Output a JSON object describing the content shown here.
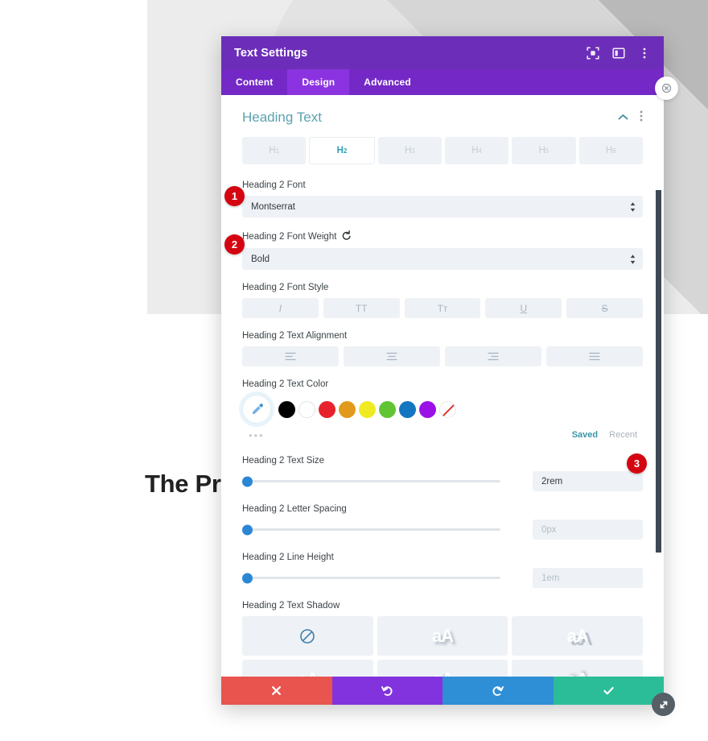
{
  "page_background": {
    "hero_text": "The Pro",
    "panel_color": "#ececec",
    "diag_color": "#b9b9b9"
  },
  "modal": {
    "title": "Text Settings",
    "header_icons": [
      {
        "name": "focus-target-icon"
      },
      {
        "name": "panel-layout-icon"
      },
      {
        "name": "more-vertical-icon"
      }
    ],
    "tabs": [
      {
        "label": "Content",
        "active": false
      },
      {
        "label": "Design",
        "active": true
      },
      {
        "label": "Advanced",
        "active": false
      }
    ],
    "section": {
      "title": "Heading Text",
      "collapse_icon": "chevron-up-icon",
      "menu_icon": "more-vertical-icon"
    },
    "heading_levels": [
      {
        "label": "H",
        "sub": "1",
        "active": false
      },
      {
        "label": "H",
        "sub": "2",
        "active": true
      },
      {
        "label": "H",
        "sub": "3",
        "active": false
      },
      {
        "label": "H",
        "sub": "4",
        "active": false
      },
      {
        "label": "H",
        "sub": "5",
        "active": false
      },
      {
        "label": "H",
        "sub": "6",
        "active": false
      }
    ],
    "fields": {
      "font": {
        "label": "Heading 2 Font",
        "value": "Montserrat"
      },
      "font_weight": {
        "label": "Heading 2 Font Weight",
        "value": "Bold",
        "has_reset": true
      },
      "font_style": {
        "label": "Heading 2 Font Style",
        "options": [
          {
            "name": "italic-icon",
            "glyph": "I"
          },
          {
            "name": "uppercase-icon",
            "glyph": "TT"
          },
          {
            "name": "small-caps-icon",
            "glyph": "Tᴛ"
          },
          {
            "name": "underline-icon",
            "glyph": "U"
          },
          {
            "name": "strikethrough-icon",
            "glyph": "S"
          }
        ]
      },
      "text_alignment": {
        "label": "Heading 2 Text Alignment",
        "options": [
          {
            "name": "align-left-icon"
          },
          {
            "name": "align-center-icon"
          },
          {
            "name": "align-right-icon"
          },
          {
            "name": "align-justify-icon"
          }
        ]
      },
      "text_color": {
        "label": "Heading 2 Text Color",
        "eyedropper": "eyedropper-icon",
        "more_dots": "•••",
        "swatches": [
          {
            "name": "swatch-black",
            "hex": "#000000"
          },
          {
            "name": "swatch-white",
            "hex": "#ffffff"
          },
          {
            "name": "swatch-red",
            "hex": "#e8222a"
          },
          {
            "name": "swatch-orange",
            "hex": "#e19a1c"
          },
          {
            "name": "swatch-yellow",
            "hex": "#f0ea22"
          },
          {
            "name": "swatch-green",
            "hex": "#61c434"
          },
          {
            "name": "swatch-blue",
            "hex": "#1476c0"
          },
          {
            "name": "swatch-purple",
            "hex": "#9c10e8"
          },
          {
            "name": "swatch-none",
            "hex": "transparent"
          }
        ],
        "saved_label": "Saved",
        "recent_label": "Recent"
      },
      "text_size": {
        "label": "Heading 2 Text Size",
        "value": "2rem",
        "is_placeholder": false,
        "thumb_pct": 0
      },
      "letter_spacing": {
        "label": "Heading 2 Letter Spacing",
        "value": "0px",
        "is_placeholder": true,
        "thumb_pct": 0
      },
      "line_height": {
        "label": "Heading 2 Line Height",
        "value": "1em",
        "is_placeholder": true,
        "thumb_pct": 0
      },
      "text_shadow": {
        "label": "Heading 2 Text Shadow",
        "cells": [
          {
            "name": "shadow-none",
            "glyph": "none"
          },
          {
            "name": "shadow-soft",
            "glyph": "aA"
          },
          {
            "name": "shadow-hard",
            "glyph": "aA"
          },
          {
            "name": "shadow-drop",
            "glyph": "aA"
          },
          {
            "name": "shadow-left",
            "glyph": "aA"
          },
          {
            "name": "shadow-up",
            "glyph": "aA"
          }
        ]
      }
    },
    "footer": [
      {
        "name": "cancel-button",
        "icon": "close-icon",
        "color": "#e9544e"
      },
      {
        "name": "undo-button",
        "icon": "undo-icon",
        "color": "#8233dd"
      },
      {
        "name": "redo-button",
        "icon": "redo-icon",
        "color": "#2e8fd6"
      },
      {
        "name": "save-button",
        "icon": "check-icon",
        "color": "#2bbd98"
      }
    ],
    "resize_handle": "resize-handle-icon",
    "side_close": "close-circle-icon"
  },
  "callouts": [
    {
      "number": "1"
    },
    {
      "number": "2"
    },
    {
      "number": "3"
    }
  ]
}
